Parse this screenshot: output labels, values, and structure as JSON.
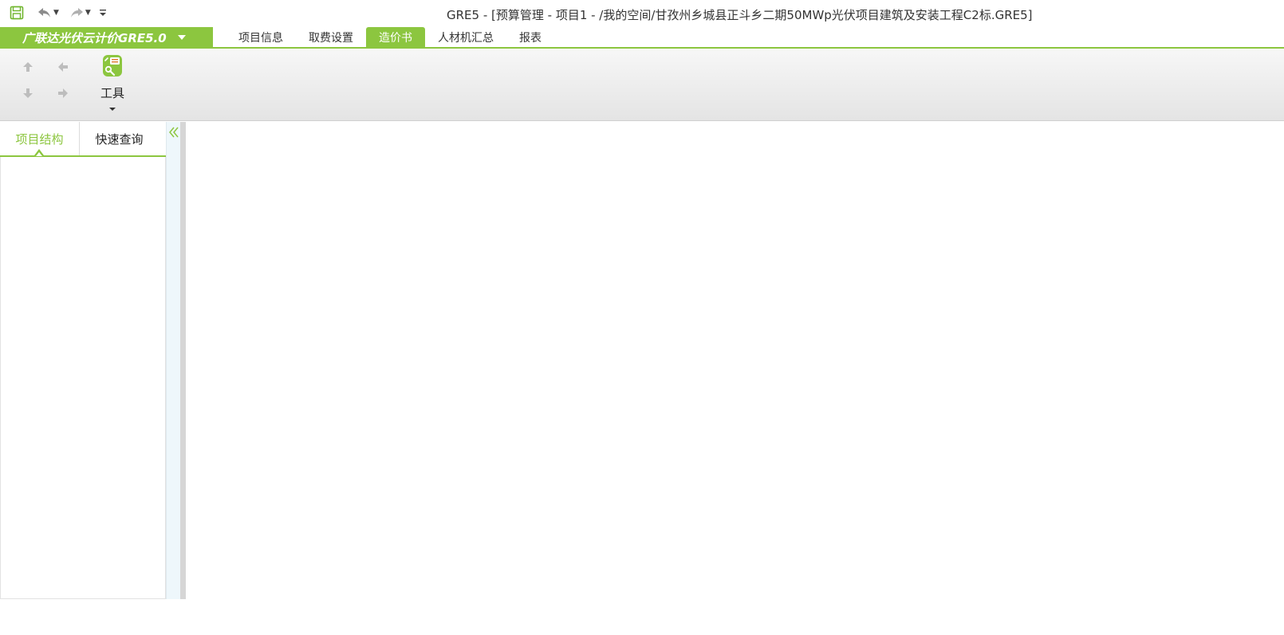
{
  "window": {
    "title": "GRE5 - [预算管理 - 项目1 - /我的空间/甘孜州乡城县正斗乡二期50MWp光伏项目建筑及安装工程C2标.GRE5]"
  },
  "quick_access": {
    "icons": [
      "save-icon",
      "undo-icon",
      "redo-icon",
      "customize-icon"
    ]
  },
  "app_menu": {
    "label": "广联达光伏云计价GRE5.0"
  },
  "ribbon_tabs": [
    {
      "label": "项目信息",
      "active": false
    },
    {
      "label": "取费设置",
      "active": false
    },
    {
      "label": "造价书",
      "active": true
    },
    {
      "label": "人材机汇总",
      "active": false
    },
    {
      "label": "报表",
      "active": false
    }
  ],
  "ribbon": {
    "tool_label": "工具"
  },
  "left_panel": {
    "tabs": [
      {
        "label": "项目结构",
        "active": true
      },
      {
        "label": "快速查询",
        "active": false
      }
    ]
  },
  "colors": {
    "accent": "#8cc63f",
    "arrow_disabled": "#bdbdbd"
  }
}
